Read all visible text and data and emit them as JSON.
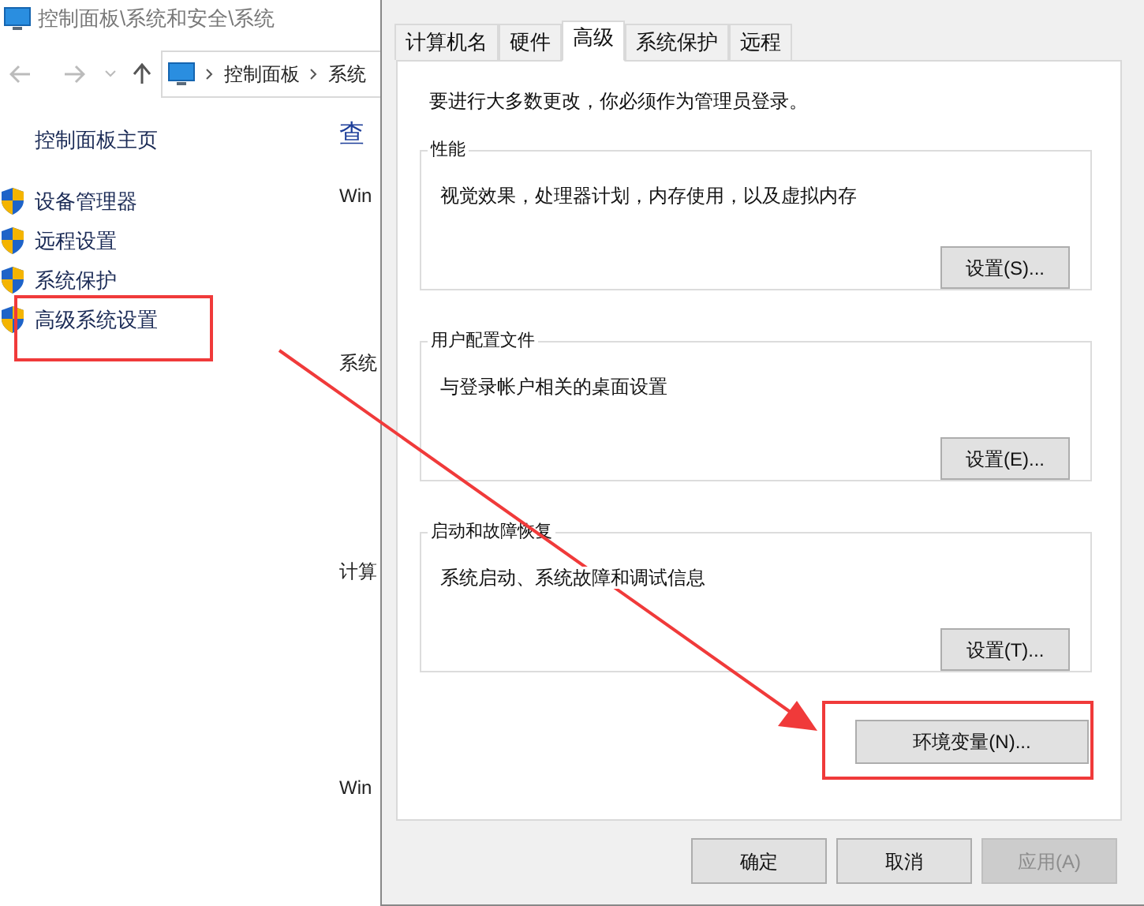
{
  "window": {
    "title": "控制面板\\系统和安全\\系统"
  },
  "address_bar": {
    "segments": [
      "控制面板",
      "系统"
    ]
  },
  "sidebar": {
    "home": "控制面板主页",
    "items": [
      {
        "label": "设备管理器"
      },
      {
        "label": "远程设置"
      },
      {
        "label": "系统保护"
      },
      {
        "label": "高级系统设置"
      }
    ]
  },
  "content": [
    {
      "kind": "title",
      "text": "查"
    },
    {
      "kind": "heading",
      "text": "Win"
    },
    {
      "kind": "heading",
      "text": "系统"
    },
    {
      "kind": "heading",
      "text": "计算"
    },
    {
      "kind": "heading",
      "text": "Win"
    }
  ],
  "dialog": {
    "tabs": [
      {
        "label": "计算机名",
        "selected": false
      },
      {
        "label": "硬件",
        "selected": false
      },
      {
        "label": "高级",
        "selected": true
      },
      {
        "label": "系统保护",
        "selected": false
      },
      {
        "label": "远程",
        "selected": false
      }
    ],
    "notice": "要进行大多数更改，你必须作为管理员登录。",
    "groups": [
      {
        "title": "性能",
        "description": "视觉效果，处理器计划，内存使用，以及虚拟内存",
        "button": "设置(S)..."
      },
      {
        "title": "用户配置文件",
        "description": "与登录帐户相关的桌面设置",
        "button": "设置(E)..."
      },
      {
        "title": "启动和故障恢复",
        "description": "系统启动、系统故障和调试信息",
        "button": "设置(T)..."
      }
    ],
    "env_button": "环境变量(N)...",
    "buttons": [
      {
        "label": "确定",
        "disabled": false
      },
      {
        "label": "取消",
        "disabled": false
      },
      {
        "label": "应用(A)",
        "disabled": true
      }
    ]
  }
}
